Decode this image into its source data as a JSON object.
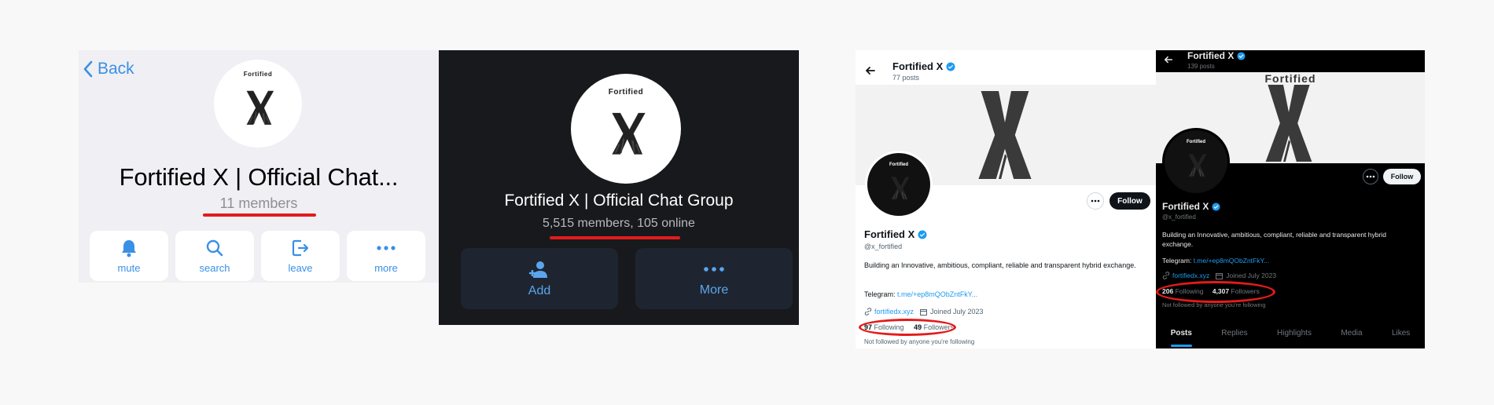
{
  "telegram_light": {
    "back_label": "Back",
    "title": "Fortified X | Official Chat...",
    "members": "11 members",
    "buttons": [
      {
        "label": "mute",
        "icon": "bell-icon"
      },
      {
        "label": "search",
        "icon": "search-icon"
      },
      {
        "label": "leave",
        "icon": "leave-icon"
      },
      {
        "label": "more",
        "icon": "more-icon"
      }
    ]
  },
  "telegram_dark": {
    "title": "Fortified X | Official Chat Group",
    "members": "5,515 members, 105 online",
    "buttons": [
      {
        "label": "Add",
        "icon": "add-user-icon"
      },
      {
        "label": "More",
        "icon": "more-icon"
      }
    ]
  },
  "x_light": {
    "name": "Fortified X",
    "posts": "77 posts",
    "handle": "@x_fortified",
    "bio": "Building an Innovative, ambitious, compliant, reliable and transparent hybrid exchange.",
    "telegram_label": "Telegram: ",
    "telegram_link": "t.me/+ep8mQObZntFkY...",
    "website": "fortifiedx.xyz",
    "joined": "Joined July 2023",
    "following_count": "97",
    "following_label": "Following",
    "followers_count": "49",
    "followers_label": "Followers",
    "not_followed": "Not followed by anyone you're following",
    "follow_label": "Follow"
  },
  "x_dark": {
    "name": "Fortified X",
    "posts": "139 posts",
    "handle": "@x_fortified",
    "bio": "Building an Innovative, ambitious, compliant, reliable and transparent hybrid exchange.",
    "telegram_label": "Telegram: ",
    "telegram_link": "t.me/+ep8mQObZntFkY...",
    "website": "fortifiedx.xyz",
    "joined": "Joined July 2023",
    "following_count": "206",
    "following_label": "Following",
    "followers_count": "4,307",
    "followers_label": "Followers",
    "not_followed": "Not followed by anyone you're following",
    "follow_label": "Follow",
    "tabs": [
      "Posts",
      "Replies",
      "Highlights",
      "Media",
      "Likes"
    ]
  },
  "logo": {
    "text": "Fortified",
    "letter": "X"
  },
  "colors": {
    "telegram_blue": "#3a90e5",
    "x_blue": "#1d9bf0",
    "highlight_red": "#e41b1b"
  }
}
